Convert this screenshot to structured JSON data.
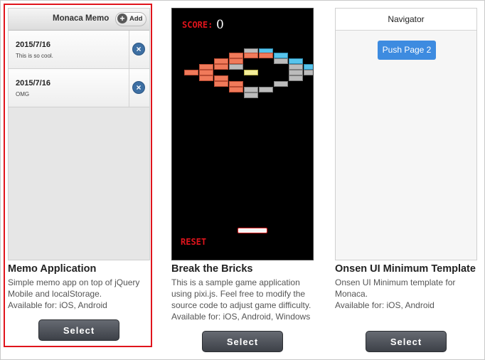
{
  "templates": [
    {
      "title": "Memo Application",
      "description": "Simple memo app on top of jQuery Mobile and localStorage.",
      "available": "Available for: iOS, Android",
      "button_label": "Select",
      "preview": {
        "header_title": "Monaca Memo",
        "add_label": "Add",
        "rows": [
          {
            "date": "2015/7/16",
            "text": "This is so cool."
          },
          {
            "date": "2015/7/16",
            "text": "OMG"
          }
        ]
      }
    },
    {
      "title": "Break the Bricks",
      "description": "This is a sample game application using pixi.js. Feel free to modify the source code to adjust game difficulty.",
      "available": "Available for: iOS, Android, Windows",
      "button_label": "Select",
      "preview": {
        "score_label": "SCORE:",
        "score_value": "0",
        "reset_label": "RESET"
      }
    },
    {
      "title": "Onsen UI Minimum Template",
      "description": "Onsen UI Minimum template for Monaca.",
      "available": "Available for: iOS, Android",
      "button_label": "Select",
      "preview": {
        "navbar_title": "Navigator",
        "push_label": "Push Page 2"
      }
    }
  ],
  "selected_index": 0,
  "colors": {
    "selection_border": "#e0141c",
    "button_bg": "#4a4e55",
    "onsen_accent": "#3d8be0"
  }
}
